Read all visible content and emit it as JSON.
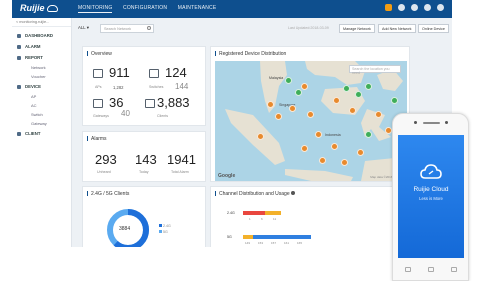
{
  "app": {
    "brand": "Ruijie",
    "nav": [
      "MONITORING",
      "CONFIGURATION",
      "MAINTENANCE"
    ],
    "active_nav": "MONITORING",
    "notification_count": "9"
  },
  "sidebar": {
    "network_selector": "< monitoring.ruijie...",
    "items": [
      {
        "label": "DASHBOARD",
        "icon": "dashboard-icon"
      },
      {
        "label": "ALARM",
        "icon": "alarm-icon"
      },
      {
        "label": "REPORT",
        "icon": "report-icon",
        "children": [
          "Network",
          "Voucher"
        ]
      },
      {
        "label": "DEVICE",
        "icon": "device-icon",
        "children": [
          "AP",
          "AC",
          "Switch",
          "Gateway"
        ]
      },
      {
        "label": "CLIENT",
        "icon": "client-icon"
      }
    ]
  },
  "filter": {
    "select_value": "ALL",
    "search_placeholder": "Search Network",
    "date_text": "Last Updated:2018-03-09",
    "buttons": [
      "Manage Network",
      "Add New Network",
      "Online Device"
    ]
  },
  "overview": {
    "title": "Overview",
    "aps": {
      "value": "911",
      "secondary": "1,282",
      "label": "APs"
    },
    "switches": {
      "value": "124",
      "secondary": "144",
      "label": "Switches"
    },
    "gateways": {
      "value": "36",
      "secondary": "40",
      "label": "Gateways"
    },
    "clients": {
      "value": "3,883",
      "label": "Clients"
    }
  },
  "map": {
    "title": "Registered Device Distribution",
    "search_placeholder": "Search the location you need",
    "labels": [
      "Malaysia",
      "Singapore",
      "Indonesia"
    ],
    "provider": "Google",
    "footer": "Map data ©2018 Google"
  },
  "alarms": {
    "title": "Alarms",
    "unheard": {
      "value": "293",
      "label": "Unheard"
    },
    "today": {
      "value": "143",
      "label": "Today"
    },
    "total": {
      "value": "1941",
      "label": "Total Alarm"
    }
  },
  "clients_chart": {
    "title": "2.4G / 5G Clients",
    "center_value": "3884",
    "legend": [
      "2.4G",
      "5G"
    ],
    "colors": [
      "#1e6fd9",
      "#5aaaf0"
    ]
  },
  "channel": {
    "title": "Channel Distribution and Usage",
    "rows": [
      "2.4G",
      "5G"
    ],
    "ticks_24g": [
      "1",
      "6",
      "11"
    ],
    "ticks_5g": [
      "149",
      "153",
      "157",
      "161",
      "165"
    ]
  },
  "phone": {
    "app_name": "Ruijie Cloud",
    "tagline": "Less is More"
  }
}
